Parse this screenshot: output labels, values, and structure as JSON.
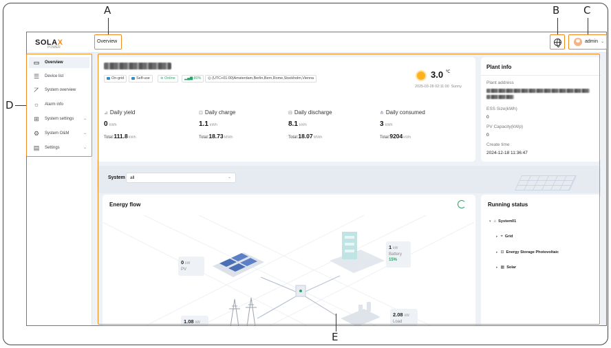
{
  "topbar": {
    "logo_brand_a": "SOLA",
    "logo_brand_x": "X",
    "logo_sub": "POWER",
    "breadcrumb": "Overview",
    "user": "admin"
  },
  "sidebar": {
    "items": [
      {
        "label": "Overview",
        "icon": "monitor-icon",
        "glyph": "▭"
      },
      {
        "label": "Device list",
        "icon": "server-icon",
        "glyph": "☰"
      },
      {
        "label": "System overview",
        "icon": "line-chart-icon",
        "glyph": "⦢"
      },
      {
        "label": "Alarm info",
        "icon": "alarm-icon",
        "glyph": "☼"
      },
      {
        "label": "System settings",
        "icon": "grid-icon",
        "glyph": "⊞",
        "chevron": "⌄"
      },
      {
        "label": "System O&M",
        "icon": "wrench-icon",
        "glyph": "⚙",
        "chevron": "⌄"
      },
      {
        "label": "Settings",
        "icon": "calendar-icon",
        "glyph": "▤",
        "chevron": "⌄"
      }
    ]
  },
  "overview": {
    "tags": [
      "On-grid",
      "Self-use",
      "Online",
      "80%",
      "(UTC+01:00)Amsterdam,Berlin,Bern,Rome,Stockholm,Vienna"
    ],
    "weather": {
      "temp": "3.0",
      "unit": "℃",
      "datetime": "2025-03-28 02:11:00",
      "condition": "Sunny"
    },
    "stats": [
      {
        "title": "Daily yield",
        "icon": "yield-icon",
        "glyph": "⊿",
        "value": "0",
        "unit": "kWh",
        "total_label": "Total:",
        "total": "111.8",
        "total_unit": "kWh"
      },
      {
        "title": "Daily charge",
        "icon": "charge-icon",
        "glyph": "⊡",
        "value": "1.1",
        "unit": "kWh",
        "total_label": "Total:",
        "total": "18.73",
        "total_unit": "MWh"
      },
      {
        "title": "Daily discharge",
        "icon": "discharge-icon",
        "glyph": "⊟",
        "value": "8.1",
        "unit": "kWh",
        "total_label": "Total:",
        "total": "18.07",
        "total_unit": "MWh"
      },
      {
        "title": "Daily consumed",
        "icon": "consumed-icon",
        "glyph": "⋔",
        "value": "3",
        "unit": "kWh",
        "total_label": "Total:",
        "total": "9204",
        "total_unit": "kWh"
      }
    ]
  },
  "plant_info": {
    "title": "Plant info",
    "address_label": "Plant address",
    "ess_label": "ESS Size(kWh)",
    "ess_value": "0",
    "pv_label": "PV Capacity(kWp)",
    "pv_value": "0",
    "create_label": "Create time",
    "create_value": "2024-12-18 11:36:47"
  },
  "system_filter": {
    "label": "System",
    "value": "all"
  },
  "energy_flow": {
    "title": "Energy flow",
    "pv": {
      "value": "0",
      "unit": "kW",
      "name": "PV"
    },
    "battery": {
      "value": "1",
      "unit": "kW",
      "name": "Battery",
      "percent": "15%"
    },
    "load": {
      "value": "2.08",
      "unit": "kW",
      "name": "Load"
    },
    "grid": {
      "value": "1.08",
      "unit": "kW"
    }
  },
  "running_status": {
    "title": "Running status",
    "root": "System01",
    "children": [
      "Grid",
      "Energy Storage Photovoltaic",
      "Solar"
    ]
  },
  "annotations": {
    "a": "A",
    "b": "B",
    "c": "C",
    "d": "D",
    "e": "E"
  },
  "colors": {
    "accent": "#f08a1c",
    "online": "#2aa36b",
    "brand": "#1a1a1a"
  }
}
